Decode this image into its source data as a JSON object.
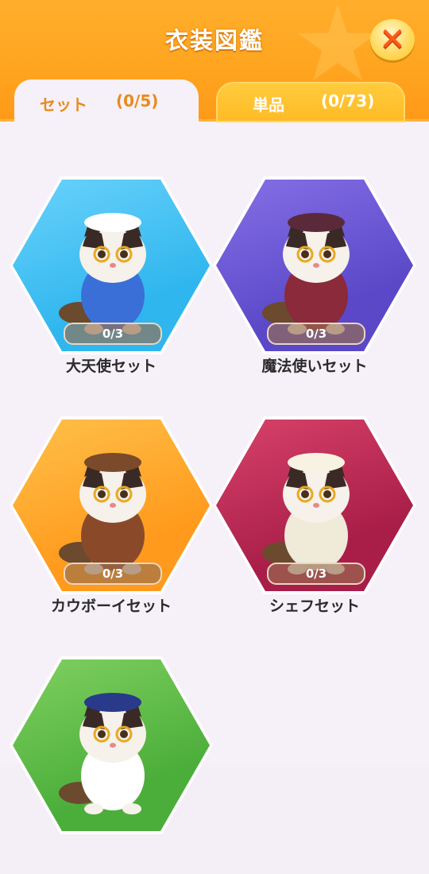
{
  "header": {
    "title": "衣装図鑑",
    "close_icon": "close-icon",
    "bg_color": "#ffa41f"
  },
  "tabs": [
    {
      "label": "セット",
      "count": "(0/5)",
      "active": true
    },
    {
      "label": "単品",
      "count": "(0/73)",
      "active": false
    }
  ],
  "sets": [
    {
      "name": "大天使セット",
      "progress": "0/3",
      "bg": [
        "#2fb6ee",
        "#6ad2fb"
      ],
      "outfit": "#3a6fd8",
      "hat": "#ffffff"
    },
    {
      "name": "魔法使いセット",
      "progress": "0/3",
      "bg": [
        "#5a48c8",
        "#8670e6"
      ],
      "outfit": "#8a2a3a",
      "hat": "#5a2a3a"
    },
    {
      "name": "カウボーイセット",
      "progress": "0/3",
      "bg": [
        "#ff9a1c",
        "#ffc04a"
      ],
      "outfit": "#8a4a2a",
      "hat": "#7a4a2a"
    },
    {
      "name": "シェフセット",
      "progress": "0/3",
      "bg": [
        "#a81e48",
        "#d8426a"
      ],
      "outfit": "#f0ead8",
      "hat": "#f8f2e2"
    },
    {
      "name": "",
      "progress": "",
      "bg": [
        "#4cae3a",
        "#7fd060"
      ],
      "outfit": "#ffffff",
      "hat": "#2a3a8a"
    }
  ]
}
